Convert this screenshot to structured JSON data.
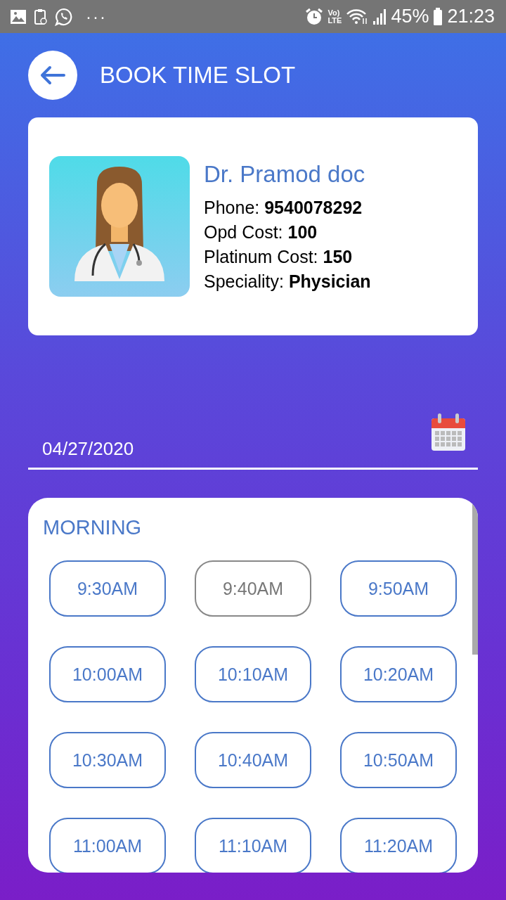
{
  "status_bar": {
    "dots": "···",
    "volte": [
      "Vo)",
      "LTE"
    ],
    "battery": "45%",
    "time": "21:23"
  },
  "header": {
    "title": "BOOK TIME SLOT"
  },
  "doctor": {
    "name": "Dr. Pramod doc",
    "details": [
      {
        "label": "Phone:",
        "value": "9540078292"
      },
      {
        "label": "Opd Cost:",
        "value": "100"
      },
      {
        "label": "Platinum Cost:",
        "value": "150"
      },
      {
        "label": "Speciality:",
        "value": "Physician"
      }
    ]
  },
  "date_field": {
    "value": "04/27/2020"
  },
  "slots": {
    "section": "MORNING",
    "items": [
      {
        "time": "9:30AM",
        "disabled": false
      },
      {
        "time": "9:40AM",
        "disabled": true
      },
      {
        "time": "9:50AM",
        "disabled": false
      },
      {
        "time": "10:00AM",
        "disabled": false
      },
      {
        "time": "10:10AM",
        "disabled": false
      },
      {
        "time": "10:20AM",
        "disabled": false
      },
      {
        "time": "10:30AM",
        "disabled": false
      },
      {
        "time": "10:40AM",
        "disabled": false
      },
      {
        "time": "10:50AM",
        "disabled": false
      },
      {
        "time": "11:00AM",
        "disabled": false
      },
      {
        "time": "11:10AM",
        "disabled": false
      },
      {
        "time": "11:20AM",
        "disabled": false
      }
    ]
  }
}
